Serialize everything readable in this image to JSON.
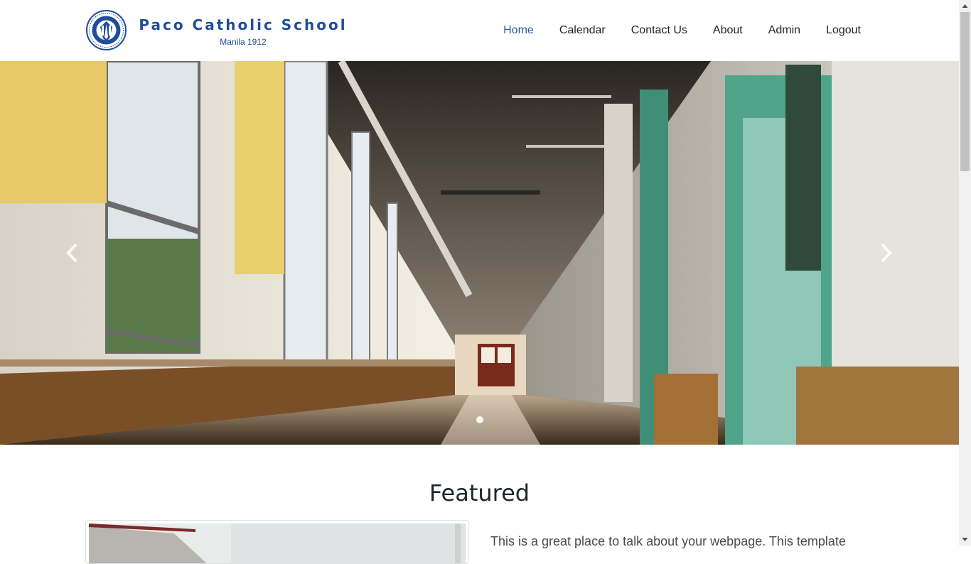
{
  "brand": {
    "name": "Paco Catholic School",
    "subtitle": "Manila 1912"
  },
  "nav": {
    "items": [
      {
        "label": "Home",
        "active": true
      },
      {
        "label": "Calendar",
        "active": false
      },
      {
        "label": "Contact Us",
        "active": false
      },
      {
        "label": "About",
        "active": false
      },
      {
        "label": "Admin",
        "active": false
      },
      {
        "label": "Logout",
        "active": false
      }
    ]
  },
  "carousel": {
    "slide_count": 1,
    "active_slide": 1,
    "prev_icon": "chevron-left-icon",
    "next_icon": "chevron-right-icon"
  },
  "featured": {
    "title": "Featured",
    "text": "This is a great place to talk about your webpage. This template"
  },
  "colors": {
    "brand": "#1e4d9c",
    "nav_active": "#2a5aa3",
    "nav_text": "#212529"
  }
}
